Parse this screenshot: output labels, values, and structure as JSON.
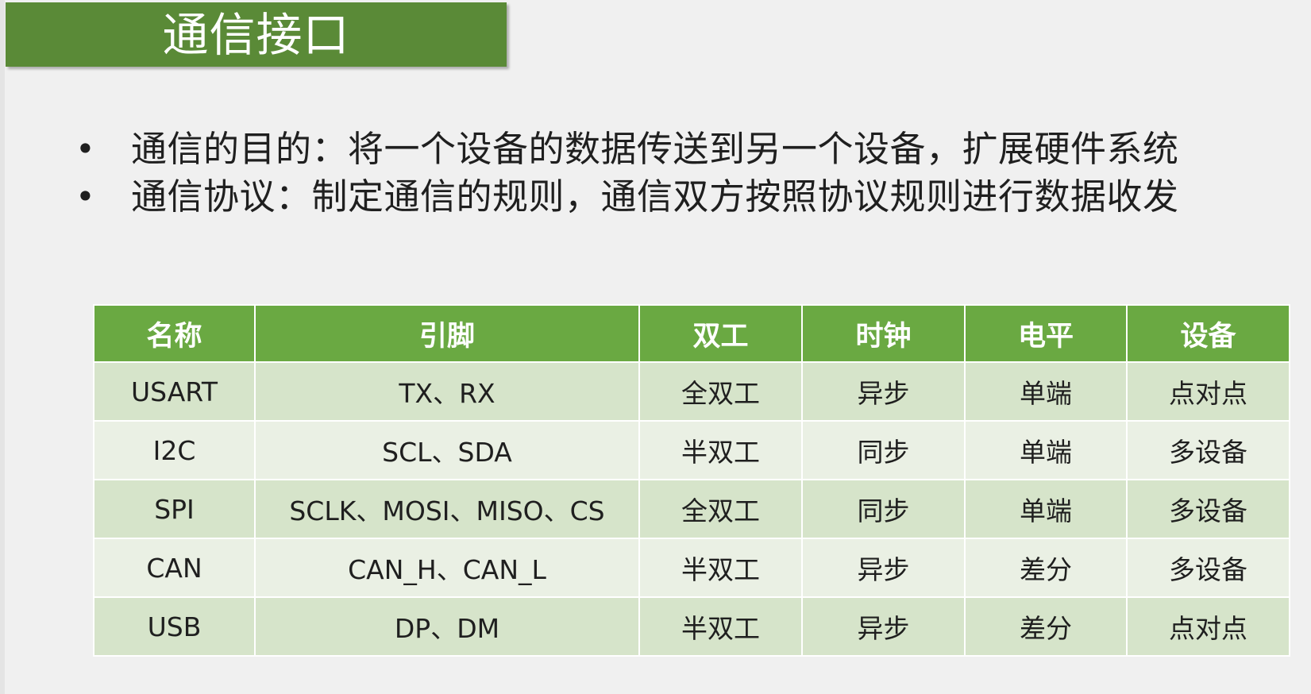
{
  "slide": {
    "title": "通信接口",
    "bullets": [
      "通信的目的：将一个设备的数据传送到另一个设备，扩展硬件系统",
      "通信协议：制定通信的规则，通信双方按照协议规则进行数据收发"
    ]
  },
  "table": {
    "headers": [
      "名称",
      "引脚",
      "双工",
      "时钟",
      "电平",
      "设备"
    ],
    "rows": [
      [
        "USART",
        "TX、RX",
        "全双工",
        "异步",
        "单端",
        "点对点"
      ],
      [
        "I2C",
        "SCL、SDA",
        "半双工",
        "同步",
        "单端",
        "多设备"
      ],
      [
        "SPI",
        "SCLK、MOSI、MISO、CS",
        "全双工",
        "同步",
        "单端",
        "多设备"
      ],
      [
        "CAN",
        "CAN_H、CAN_L",
        "半双工",
        "异步",
        "差分",
        "多设备"
      ],
      [
        "USB",
        "DP、DM",
        "半双工",
        "异步",
        "差分",
        "点对点"
      ]
    ]
  },
  "colors": {
    "title_background": "#5a8a37",
    "table_header": "#6aa942",
    "table_row_dark": "#d6e4ca",
    "table_row_light": "#eaf0e4"
  }
}
